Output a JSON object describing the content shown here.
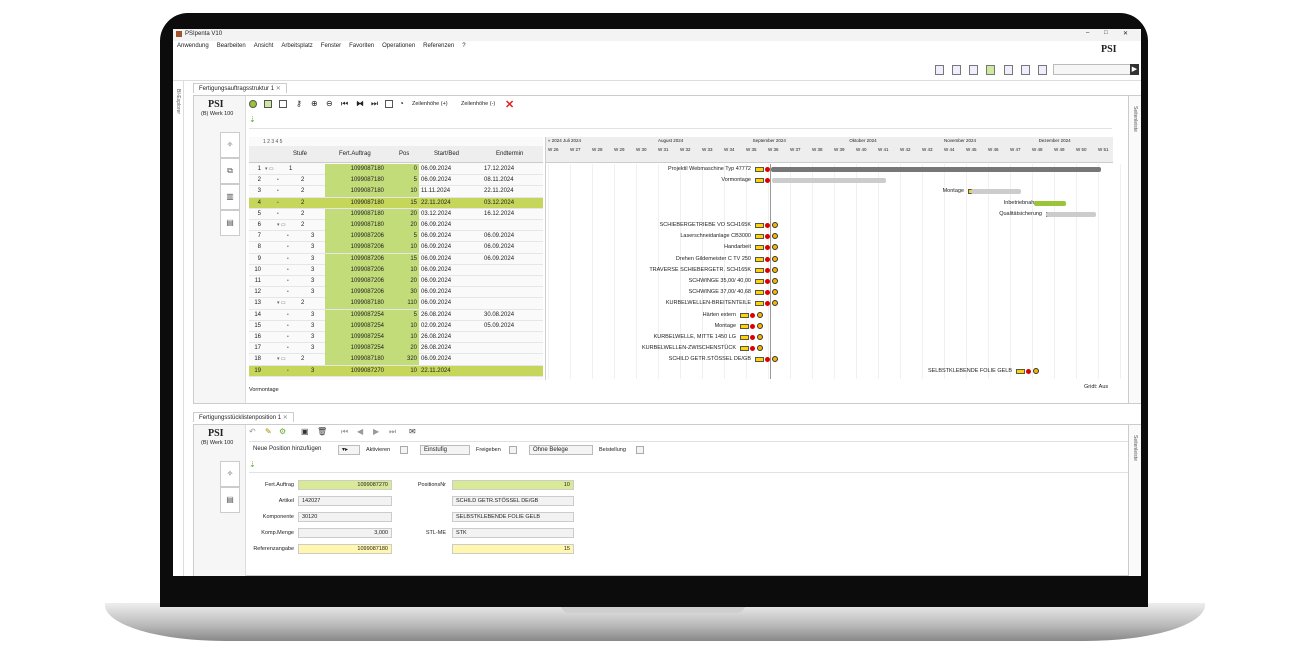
{
  "app": {
    "title": "PSIpenta V10",
    "logo": "PSI",
    "window_buttons": [
      "–",
      "□",
      "✕"
    ]
  },
  "menu": [
    "Anwendung",
    "Bearbeiten",
    "Ansicht",
    "Arbeitsplatz",
    "Fenster",
    "Favoriten",
    "Operationen",
    "Referenzen",
    "?"
  ],
  "left_strip": {
    "label": "BI-Explorer"
  },
  "top_tab": {
    "label": "Fertigungsauftragsstruktur 1",
    "close": "✕"
  },
  "top_panel": {
    "psi": "PSI",
    "werk": "(B) Werk 100",
    "zeilenhoehe_plus": "Zeilenhöhe (+)",
    "zeilenhoehe_minus": "Zeilenhöhe (-)",
    "right_label": "Seitenleiste",
    "footer_left": "Vormontage",
    "footer_right": "Gridt: Aus"
  },
  "table": {
    "levels": "1 2 3 4 5",
    "headers": [
      "Stufe",
      "Fert.Auftrag",
      "Pos",
      "Start/Bed",
      "Endtermin"
    ],
    "rows": [
      {
        "n": "1",
        "stufe": "1",
        "auftrag": "1099087180",
        "pos": "0",
        "start": "06.09.2024",
        "end": "17.12.2024"
      },
      {
        "n": "2",
        "stufe": "2",
        "auftrag": "1099087180",
        "pos": "5",
        "start": "06.09.2024",
        "end": "08.11.2024"
      },
      {
        "n": "3",
        "stufe": "2",
        "auftrag": "1099087180",
        "pos": "10",
        "start": "11.11.2024",
        "end": "22.11.2024"
      },
      {
        "n": "4",
        "stufe": "2",
        "auftrag": "1099087180",
        "pos": "15",
        "start": "22.11.2024",
        "end": "03.12.2024"
      },
      {
        "n": "5",
        "stufe": "2",
        "auftrag": "1099087180",
        "pos": "20",
        "start": "03.12.2024",
        "end": "16.12.2024"
      },
      {
        "n": "6",
        "stufe": "2",
        "auftrag": "1099087180",
        "pos": "20",
        "start": "06.09.2024",
        "end": ""
      },
      {
        "n": "7",
        "stufe": "3",
        "auftrag": "1099087206",
        "pos": "5",
        "start": "06.09.2024",
        "end": "06.09.2024"
      },
      {
        "n": "8",
        "stufe": "3",
        "auftrag": "1099087206",
        "pos": "10",
        "start": "06.09.2024",
        "end": "06.09.2024"
      },
      {
        "n": "9",
        "stufe": "3",
        "auftrag": "1099087206",
        "pos": "15",
        "start": "06.09.2024",
        "end": "06.09.2024"
      },
      {
        "n": "10",
        "stufe": "3",
        "auftrag": "1099087206",
        "pos": "10",
        "start": "06.09.2024",
        "end": ""
      },
      {
        "n": "11",
        "stufe": "3",
        "auftrag": "1099087206",
        "pos": "20",
        "start": "06.09.2024",
        "end": ""
      },
      {
        "n": "12",
        "stufe": "3",
        "auftrag": "1099087206",
        "pos": "30",
        "start": "06.09.2024",
        "end": ""
      },
      {
        "n": "13",
        "stufe": "2",
        "auftrag": "1099087180",
        "pos": "110",
        "start": "06.09.2024",
        "end": ""
      },
      {
        "n": "14",
        "stufe": "3",
        "auftrag": "1099087254",
        "pos": "5",
        "start": "26.08.2024",
        "end": "30.08.2024"
      },
      {
        "n": "15",
        "stufe": "3",
        "auftrag": "1099087254",
        "pos": "10",
        "start": "02.09.2024",
        "end": "05.09.2024"
      },
      {
        "n": "16",
        "stufe": "3",
        "auftrag": "1099087254",
        "pos": "10",
        "start": "26.08.2024",
        "end": ""
      },
      {
        "n": "17",
        "stufe": "3",
        "auftrag": "1099087254",
        "pos": "20",
        "start": "26.08.2024",
        "end": ""
      },
      {
        "n": "18",
        "stufe": "2",
        "auftrag": "1099087180",
        "pos": "320",
        "start": "06.09.2024",
        "end": ""
      },
      {
        "n": "19",
        "stufe": "3",
        "auftrag": "1099087270",
        "pos": "10",
        "start": "22.11.2024",
        "end": ""
      }
    ]
  },
  "gantt": {
    "months": [
      "« 2024 Juli 2024",
      "August 2024",
      "September 2024",
      "Oktober 2024",
      "November 2024",
      "Dezember 2024"
    ],
    "weeks": [
      "W 26",
      "W 27",
      "W 28",
      "W 29",
      "W 30",
      "W 31",
      "W 32",
      "W 33",
      "W 34",
      "W 35",
      "W 36",
      "W 37",
      "W 38",
      "W 39",
      "W 40",
      "W 41",
      "W 42",
      "W 43",
      "W 44",
      "W 45",
      "W 46",
      "W 47",
      "W 48",
      "W 49",
      "W 50",
      "W 51"
    ],
    "labels": [
      "Projektil Webmaschine Typ 47772",
      "Vormontage",
      "Montage",
      "Inbetriebnahme",
      "Qualitätsicherung",
      "SCHIEBERGETRIEBE VO   SCH165K",
      "Laserschneidanlage CB3000",
      "Handarbeit",
      "Drehen Gildemeister C TV 250",
      "TRAVERSE SCHIEBERGETR. SCH165K",
      "SCHWINGE  35,00/ 40,00",
      "SCHWINGE  37,00/ 40,68",
      "KURBELWELLEN-BREITENTEILE",
      "Härten extern",
      "Montage",
      "KURBELWELLE, MITTE 1450 LG",
      "KURBELWELLEN-ZWISCHENSTÜCK",
      "SCHILD GETR.STÖSSEL      DE/GB",
      "SELBSTKLEBENDE FOLIE GELB"
    ]
  },
  "bottom_tab": {
    "label": "Fertigungsstücklistenposition 1",
    "close": "✕"
  },
  "bottom_panel": {
    "psi": "PSI",
    "werk": "(B) Werk 100",
    "right_label": "Seitenleiste",
    "actions": {
      "neue_position": "Neue Position hinzufügen",
      "aktivieren": "Aktivieren",
      "einstufig": "Einstufig",
      "freigeben": "Freigeben",
      "ohne_belege": "Ohne Belege",
      "beistellung": "Beistellung"
    },
    "form": {
      "fert_auftrag_label": "Fert.Auftrag",
      "fert_auftrag": "1099087270",
      "positionsnr_label": "PositionsNr",
      "positionsnr": "10",
      "artikel_label": "Artikel",
      "artikel": "142027",
      "artikel_desc": "SCHILD GETR.STÖSSEL     DE/GB",
      "komponente_label": "Komponente",
      "komponente": "30120",
      "komponente_desc": "SELBSTKLEBENDE FOLIE GELB",
      "kompmenge_label": "Komp.Menge",
      "kompmenge": "3,000",
      "stlme_label": "STL-ME",
      "stlme": "STK",
      "referenz_label": "Referenzangabe",
      "referenz": "1099087180",
      "referenz_pos": "15"
    }
  }
}
